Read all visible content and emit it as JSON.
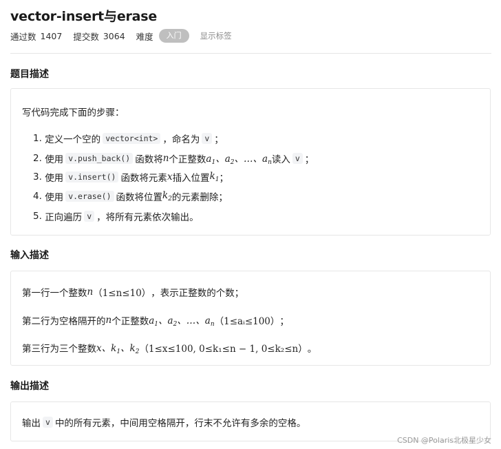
{
  "problem": {
    "title": "vector-insert与erase",
    "pass_label": "通过数",
    "pass_count": "1407",
    "submit_label": "提交数",
    "submit_count": "3064",
    "difficulty_label": "难度",
    "difficulty": "入门",
    "show_tags": "显示标签"
  },
  "description": {
    "heading": "题目描述",
    "intro": "写代码完成下面的步骤：",
    "steps": [
      {
        "num": "1.",
        "pre": "定义一个空的",
        "code": "vector<int>",
        "mid": "，命名为",
        "code2": "v",
        "post": "；"
      },
      {
        "num": "2.",
        "pre": "使用",
        "code": "v.push_back()",
        "post": "函数将",
        "math_n": "n",
        "post2": "个正整数",
        "post3": "读入",
        "code2": "v",
        "end": "；"
      },
      {
        "num": "3.",
        "pre": "使用",
        "code": "v.insert()",
        "post": "函数将元素",
        "math_x": "x",
        "post2": "插入位置",
        "math_k": "k",
        "sub": "1",
        "end": "；"
      },
      {
        "num": "4.",
        "pre": "使用",
        "code": "v.erase()",
        "post": "函数将位置",
        "math_k": "k",
        "sub": "2",
        "end": "的元素删除；"
      },
      {
        "num": "5.",
        "pre": "正向遍历",
        "code": "v",
        "post": "，将所有元素依次输出。"
      }
    ]
  },
  "input": {
    "heading": "输入描述",
    "line1_pre": "第一行一个整数",
    "line1_math": "n",
    "line1_range": "（1≤n≤10）",
    "line1_post": "，表示正整数的个数；",
    "line2_pre": "第二行为空格隔开的",
    "line2_math": "n",
    "line2_mid": "个正整数",
    "line2_range": "（1≤aᵢ≤100）",
    "line2_post": "；",
    "line3_pre": "第三行为三个整数",
    "line3_range": "（1≤x≤100, 0≤k₁≤n − 1, 0≤k₂≤n）",
    "line3_post": "。"
  },
  "output": {
    "heading": "输出描述",
    "pre": "输出",
    "code": "v",
    "post": "中的所有元素，中间用空格隔开，行末不允许有多余的空格。"
  },
  "watermark": "CSDN @Polaris北极星少女"
}
